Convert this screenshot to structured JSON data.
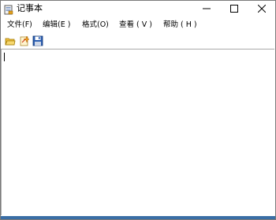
{
  "window": {
    "title": "记事本",
    "buttons": {
      "minimize": "minimize-icon",
      "maximize": "maximize-icon",
      "close": "close-icon"
    }
  },
  "menubar": {
    "items": [
      {
        "label": "文件(F)"
      },
      {
        "label": "编辑(E )"
      },
      {
        "label": "格式(O)"
      },
      {
        "label": "查看 ( V )"
      },
      {
        "label": "帮助 ( H )"
      }
    ]
  },
  "toolbar": {
    "buttons": [
      {
        "icon": "open-folder-icon"
      },
      {
        "icon": "new-sparkle-icon"
      },
      {
        "icon": "save-disk-icon"
      }
    ]
  },
  "editor": {
    "text": ""
  },
  "colors": {
    "accent": "#3a6ea5",
    "folder": "#f0c040",
    "disk": "#2a5db0"
  }
}
